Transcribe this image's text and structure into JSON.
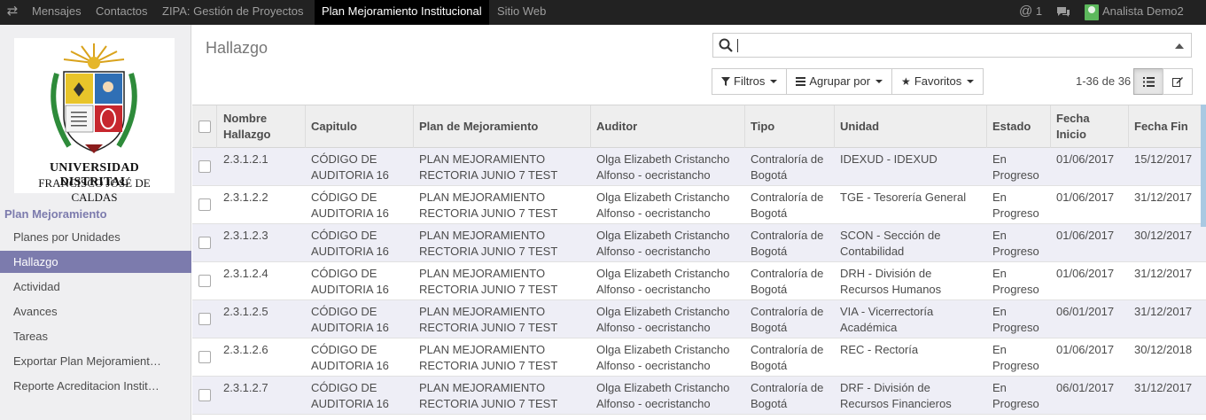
{
  "topbar": {
    "menu_toggle": "⇄",
    "nav": [
      "Mensajes",
      "Contactos",
      "ZIPA: Gestión de Proyectos",
      "Plan Mejoramiento Institucional",
      "Sitio Web"
    ],
    "active_nav": "Plan Mejoramiento Institucional",
    "mentions": "1",
    "user": "Analista Demo2"
  },
  "logo": {
    "line1": "UNIVERSIDAD DISTRITAL",
    "line2": "FRANCISCO JOSÉ DE CALDAS"
  },
  "sidebar": {
    "section": "Plan Mejoramiento",
    "items": [
      "Planes por Unidades",
      "Hallazgo",
      "Actividad",
      "Avances",
      "Tareas",
      "Exportar Plan Mejoramient…",
      "Reporte Acreditacion Instit…"
    ],
    "active": "Hallazgo"
  },
  "page": {
    "title": "Hallazgo"
  },
  "search": {
    "value": ""
  },
  "buttons": {
    "filters": "Filtros",
    "group_by": "Agrupar por",
    "favorites": "Favoritos"
  },
  "pager": {
    "value": "1-36 de 36"
  },
  "columns": [
    "Nombre Hallazgo",
    "Capitulo",
    "Plan de Mejoramiento",
    "Auditor",
    "Tipo",
    "Unidad",
    "Estado",
    "Fecha Inicio",
    "Fecha Fin"
  ],
  "rows": [
    {
      "nombre": "2.3.1.2.1",
      "capitulo": [
        "CÓDIGO DE",
        "AUDITORIA 16"
      ],
      "plan": [
        "PLAN MEJORAMIENTO",
        "RECTORIA JUNIO 7 TEST"
      ],
      "auditor": [
        "Olga Elizabeth Cristancho",
        "Alfonso - oecristancho"
      ],
      "tipo": [
        "Contraloría de",
        "Bogotá"
      ],
      "unidad": [
        "IDEXUD - IDEXUD",
        ""
      ],
      "estado": [
        "En",
        "Progreso"
      ],
      "inicio": "01/06/2017",
      "fin": "15/12/2017"
    },
    {
      "nombre": "2.3.1.2.2",
      "capitulo": [
        "CÓDIGO DE",
        "AUDITORIA 16"
      ],
      "plan": [
        "PLAN MEJORAMIENTO",
        "RECTORIA JUNIO 7 TEST"
      ],
      "auditor": [
        "Olga Elizabeth Cristancho",
        "Alfonso - oecristancho"
      ],
      "tipo": [
        "Contraloría de",
        "Bogotá"
      ],
      "unidad": [
        "TGE - Tesorería General",
        ""
      ],
      "estado": [
        "En",
        "Progreso"
      ],
      "inicio": "01/06/2017",
      "fin": "31/12/2017"
    },
    {
      "nombre": "2.3.1.2.3",
      "capitulo": [
        "CÓDIGO DE",
        "AUDITORIA 16"
      ],
      "plan": [
        "PLAN MEJORAMIENTO",
        "RECTORIA JUNIO 7 TEST"
      ],
      "auditor": [
        "Olga Elizabeth Cristancho",
        "Alfonso - oecristancho"
      ],
      "tipo": [
        "Contraloría de",
        "Bogotá"
      ],
      "unidad": [
        "SCON - Sección de",
        "Contabilidad"
      ],
      "estado": [
        "En",
        "Progreso"
      ],
      "inicio": "01/06/2017",
      "fin": "30/12/2017"
    },
    {
      "nombre": "2.3.1.2.4",
      "capitulo": [
        "CÓDIGO DE",
        "AUDITORIA 16"
      ],
      "plan": [
        "PLAN MEJORAMIENTO",
        "RECTORIA JUNIO 7 TEST"
      ],
      "auditor": [
        "Olga Elizabeth Cristancho",
        "Alfonso - oecristancho"
      ],
      "tipo": [
        "Contraloría de",
        "Bogotá"
      ],
      "unidad": [
        "DRH - División de",
        "Recursos Humanos"
      ],
      "estado": [
        "En",
        "Progreso"
      ],
      "inicio": "01/06/2017",
      "fin": "31/12/2017"
    },
    {
      "nombre": "2.3.1.2.5",
      "capitulo": [
        "CÓDIGO DE",
        "AUDITORIA 16"
      ],
      "plan": [
        "PLAN MEJORAMIENTO",
        "RECTORIA JUNIO 7 TEST"
      ],
      "auditor": [
        "Olga Elizabeth Cristancho",
        "Alfonso - oecristancho"
      ],
      "tipo": [
        "Contraloría de",
        "Bogotá"
      ],
      "unidad": [
        "VIA - Vicerrectoría",
        "Académica"
      ],
      "estado": [
        "En",
        "Progreso"
      ],
      "inicio": "06/01/2017",
      "fin": "31/12/2017"
    },
    {
      "nombre": "2.3.1.2.6",
      "capitulo": [
        "CÓDIGO DE",
        "AUDITORIA 16"
      ],
      "plan": [
        "PLAN MEJORAMIENTO",
        "RECTORIA JUNIO 7 TEST"
      ],
      "auditor": [
        "Olga Elizabeth Cristancho",
        "Alfonso - oecristancho"
      ],
      "tipo": [
        "Contraloría de",
        "Bogotá"
      ],
      "unidad": [
        "REC - Rectoría",
        ""
      ],
      "estado": [
        "En",
        "Progreso"
      ],
      "inicio": "01/06/2017",
      "fin": "30/12/2018"
    },
    {
      "nombre": "2.3.1.2.7",
      "capitulo": [
        "CÓDIGO DE",
        "AUDITORIA 16"
      ],
      "plan": [
        "PLAN MEJORAMIENTO",
        "RECTORIA JUNIO 7 TEST"
      ],
      "auditor": [
        "Olga Elizabeth Cristancho",
        "Alfonso - oecristancho"
      ],
      "tipo": [
        "Contraloría de",
        "Bogotá"
      ],
      "unidad": [
        "DRF - División de",
        "Recursos Financieros"
      ],
      "estado": [
        "En",
        "Progreso"
      ],
      "inicio": "06/01/2017",
      "fin": "31/12/2017"
    }
  ]
}
